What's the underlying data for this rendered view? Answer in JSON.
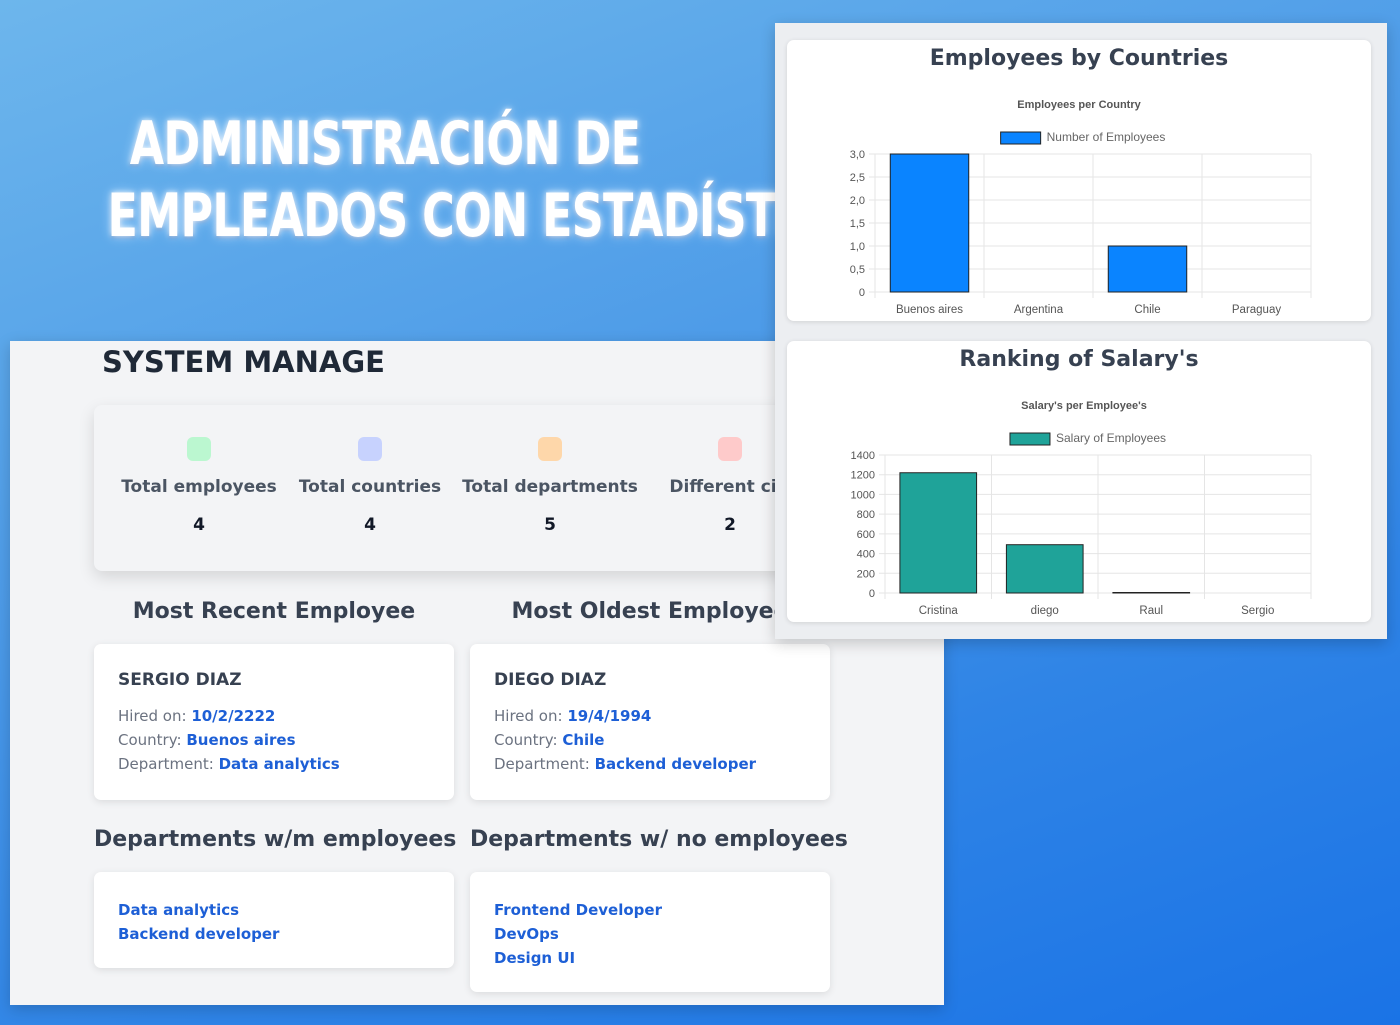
{
  "hero": {
    "line1": "ADMINISTRACIÓN DE",
    "line2": "EMPLEADOS CON ESTADÍSTICAS"
  },
  "dashboard": {
    "title": "SYSTEM MANAGE",
    "stats": [
      {
        "label": "Total employees",
        "value": "4",
        "color": "#bbf7d0"
      },
      {
        "label": "Total countries",
        "value": "4",
        "color": "#c7d2fe"
      },
      {
        "label": "Total departments",
        "value": "5",
        "color": "#fed7aa"
      },
      {
        "label": "Different citi",
        "value": "2",
        "color": "#fecaca"
      }
    ],
    "recent": {
      "heading": "Most Recent Employee",
      "name": "SERGIO DIAZ",
      "hired_label": "Hired on: ",
      "hired": "10/2/2222",
      "country_label": "Country: ",
      "country": "Buenos aires",
      "dept_label": "Department: ",
      "dept": "Data analytics"
    },
    "oldest": {
      "heading": "Most Oldest Employee",
      "name": "DIEGO DIAZ",
      "hired_label": "Hired on: ",
      "hired": "19/4/1994",
      "country_label": "Country: ",
      "country": "Chile",
      "dept_label": "Department: ",
      "dept": "Backend developer"
    },
    "with_emp": {
      "heading": "Departments w/m employees",
      "items": [
        "Data analytics",
        "Backend developer"
      ]
    },
    "no_emp": {
      "heading": "Departments w/ no employees",
      "items": [
        "Frontend Developer",
        "DevOps",
        "Design UI"
      ]
    }
  },
  "charts": {
    "countries": {
      "heading": "Employees by Countries"
    },
    "salary": {
      "heading": "Ranking of Salary's"
    }
  },
  "chart_data": [
    {
      "type": "bar",
      "title": "Employees per Country",
      "categories": [
        "Buenos aires",
        "Argentina",
        "Chile",
        "Paraguay"
      ],
      "series": [
        {
          "name": "Number of Employees",
          "values": [
            3,
            0,
            1,
            0
          ]
        }
      ],
      "ylim": [
        0,
        3
      ],
      "yticks": [
        "0",
        "0,5",
        "1,0",
        "1,5",
        "2,0",
        "2,5",
        "3,0"
      ],
      "bar_color": "#0a84ff",
      "grid": true,
      "legend": "top"
    },
    {
      "type": "bar",
      "title": "Salary's per Employee's",
      "categories": [
        "Cristina",
        "diego",
        "Raul",
        "Sergio"
      ],
      "series": [
        {
          "name": "Salary of Employees",
          "values": [
            1220,
            490,
            5,
            0
          ]
        }
      ],
      "ylim": [
        0,
        1400
      ],
      "yticks": [
        "0",
        "200",
        "400",
        "600",
        "800",
        "1000",
        "1200",
        "1400"
      ],
      "bar_color": "#1fa399",
      "grid": true,
      "legend": "top"
    }
  ]
}
